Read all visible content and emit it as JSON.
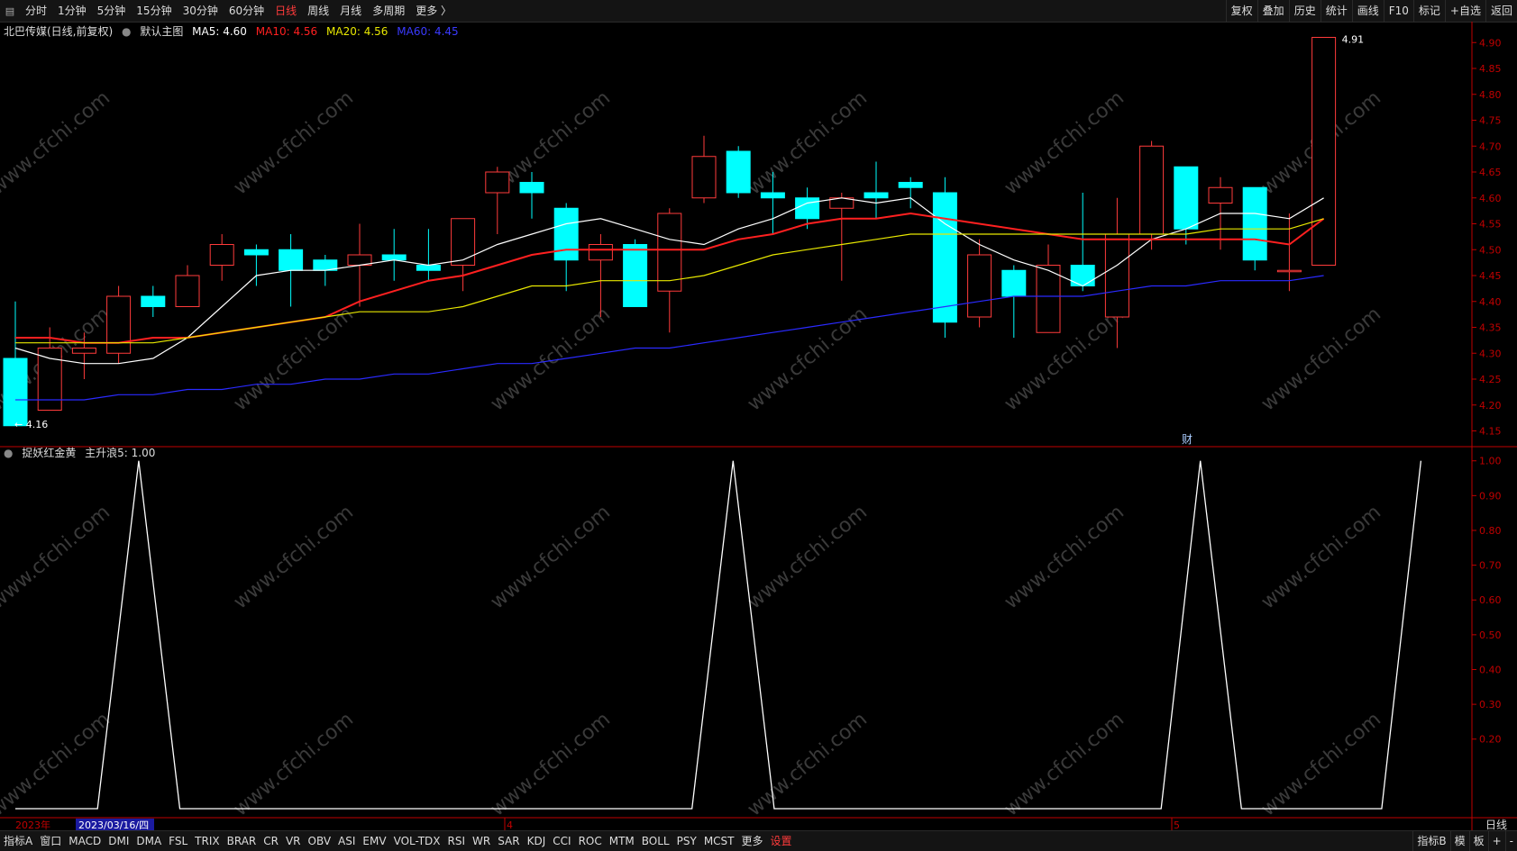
{
  "topbar": {
    "periods": [
      "分时",
      "1分钟",
      "5分钟",
      "15分钟",
      "30分钟",
      "60分钟",
      "日线",
      "周线",
      "月线",
      "多周期",
      "更多 〉"
    ],
    "active_period": "日线",
    "tools": [
      "复权",
      "叠加",
      "历史",
      "统计",
      "画线",
      "F10",
      "标记",
      "+自选",
      "返回"
    ]
  },
  "legend_main": {
    "stock": "北巴传媒(日线,前复权)",
    "main_label": "默认主图",
    "ma5": "MA5: 4.60",
    "ma10": "MA10: 4.56",
    "ma20": "MA20: 4.56",
    "ma60": "MA60: 4.45"
  },
  "legend_sub": {
    "name": "捉妖红金黄",
    "value": "主升浪5: 1.00"
  },
  "annotations": {
    "high": "4.91",
    "low": "4.16",
    "fin_marker": "财"
  },
  "xaxis": {
    "year": "2023年",
    "cursor_date": "2023/03/16/四",
    "month4": "4",
    "month5": "5",
    "period_label": "日线"
  },
  "bottombar": {
    "items": [
      "指标A",
      "窗口",
      "MACD",
      "DMI",
      "DMA",
      "FSL",
      "TRIX",
      "BRAR",
      "CR",
      "VR",
      "OBV",
      "ASI",
      "EMV",
      "VOL-TDX",
      "RSI",
      "WR",
      "SAR",
      "KDJ",
      "CCI",
      "ROC",
      "MTM",
      "BOLL",
      "PSY",
      "MCST",
      "更多",
      "设置"
    ],
    "right": [
      "指标B",
      "模",
      "板",
      "+",
      "-"
    ]
  },
  "watermark": "www.cfchi.com",
  "colors": {
    "up": "#ff3b3b",
    "down": "#00ffff",
    "ma5": "#ffffff",
    "ma10": "#ff2020",
    "ma20": "#e8e800",
    "ma60": "#2a2aff",
    "axis": "#c00000",
    "indicator": "#ffffff"
  },
  "chart_data": [
    {
      "type": "candlestick",
      "ylim": [
        4.13,
        4.93
      ],
      "y_ticks": [
        "4.15",
        "4.20",
        "4.25",
        "4.30",
        "4.35",
        "4.40",
        "4.45",
        "4.50",
        "4.55",
        "4.60",
        "4.65",
        "4.70",
        "4.75",
        "4.80",
        "4.85",
        "4.90"
      ],
      "candles": [
        {
          "o": 4.29,
          "c": 4.16,
          "h": 4.4,
          "l": 4.16
        },
        {
          "o": 4.19,
          "c": 4.31,
          "h": 4.35,
          "l": 4.19
        },
        {
          "o": 4.3,
          "c": 4.31,
          "h": 4.34,
          "l": 4.25
        },
        {
          "o": 4.3,
          "c": 4.41,
          "h": 4.43,
          "l": 4.28
        },
        {
          "o": 4.41,
          "c": 4.39,
          "h": 4.43,
          "l": 4.37
        },
        {
          "o": 4.39,
          "c": 4.45,
          "h": 4.47,
          "l": 4.39
        },
        {
          "o": 4.47,
          "c": 4.51,
          "h": 4.53,
          "l": 4.44
        },
        {
          "o": 4.5,
          "c": 4.49,
          "h": 4.51,
          "l": 4.43
        },
        {
          "o": 4.5,
          "c": 4.46,
          "h": 4.53,
          "l": 4.39
        },
        {
          "o": 4.48,
          "c": 4.46,
          "h": 4.49,
          "l": 4.43
        },
        {
          "o": 4.47,
          "c": 4.49,
          "h": 4.55,
          "l": 4.39
        },
        {
          "o": 4.49,
          "c": 4.48,
          "h": 4.54,
          "l": 4.44
        },
        {
          "o": 4.47,
          "c": 4.46,
          "h": 4.54,
          "l": 4.44
        },
        {
          "o": 4.47,
          "c": 4.56,
          "h": 4.56,
          "l": 4.42
        },
        {
          "o": 4.61,
          "c": 4.65,
          "h": 4.66,
          "l": 4.53
        },
        {
          "o": 4.63,
          "c": 4.61,
          "h": 4.65,
          "l": 4.56
        },
        {
          "o": 4.58,
          "c": 4.48,
          "h": 4.59,
          "l": 4.42
        },
        {
          "o": 4.48,
          "c": 4.51,
          "h": 4.53,
          "l": 4.37
        },
        {
          "o": 4.51,
          "c": 4.39,
          "h": 4.52,
          "l": 4.39
        },
        {
          "o": 4.42,
          "c": 4.57,
          "h": 4.58,
          "l": 4.34
        },
        {
          "o": 4.6,
          "c": 4.68,
          "h": 4.72,
          "l": 4.59
        },
        {
          "o": 4.69,
          "c": 4.61,
          "h": 4.7,
          "l": 4.6
        },
        {
          "o": 4.61,
          "c": 4.6,
          "h": 4.65,
          "l": 4.53
        },
        {
          "o": 4.6,
          "c": 4.56,
          "h": 4.62,
          "l": 4.54
        },
        {
          "o": 4.58,
          "c": 4.6,
          "h": 4.61,
          "l": 4.44
        },
        {
          "o": 4.61,
          "c": 4.6,
          "h": 4.67,
          "l": 4.56
        },
        {
          "o": 4.63,
          "c": 4.62,
          "h": 4.64,
          "l": 4.58
        },
        {
          "o": 4.61,
          "c": 4.36,
          "h": 4.64,
          "l": 4.33
        },
        {
          "o": 4.37,
          "c": 4.49,
          "h": 4.52,
          "l": 4.35
        },
        {
          "o": 4.46,
          "c": 4.41,
          "h": 4.47,
          "l": 4.33
        },
        {
          "o": 4.34,
          "c": 4.47,
          "h": 4.51,
          "l": 4.34
        },
        {
          "o": 4.47,
          "c": 4.43,
          "h": 4.61,
          "l": 4.42
        },
        {
          "o": 4.37,
          "c": 4.53,
          "h": 4.6,
          "l": 4.31
        },
        {
          "o": 4.53,
          "c": 4.7,
          "h": 4.71,
          "l": 4.5
        },
        {
          "o": 4.66,
          "c": 4.54,
          "h": 4.66,
          "l": 4.51
        },
        {
          "o": 4.59,
          "c": 4.62,
          "h": 4.64,
          "l": 4.5
        },
        {
          "o": 4.62,
          "c": 4.48,
          "h": 4.62,
          "l": 4.46
        },
        {
          "o": 4.46,
          "c": 4.46,
          "h": 4.57,
          "l": 4.42
        },
        {
          "o": 4.47,
          "c": 4.91,
          "h": 4.91,
          "l": 4.47
        }
      ],
      "series": [
        {
          "name": "MA5",
          "values": [
            4.31,
            4.29,
            4.28,
            4.28,
            4.29,
            4.33,
            4.39,
            4.45,
            4.46,
            4.46,
            4.47,
            4.48,
            4.47,
            4.48,
            4.51,
            4.53,
            4.55,
            4.56,
            4.54,
            4.52,
            4.51,
            4.54,
            4.56,
            4.59,
            4.6,
            4.59,
            4.6,
            4.55,
            4.51,
            4.48,
            4.46,
            4.43,
            4.47,
            4.52,
            4.54,
            4.57,
            4.57,
            4.56,
            4.6
          ]
        },
        {
          "name": "MA10",
          "values": [
            4.33,
            4.33,
            4.32,
            4.32,
            4.33,
            4.33,
            4.34,
            4.35,
            4.36,
            4.37,
            4.4,
            4.42,
            4.44,
            4.45,
            4.47,
            4.49,
            4.5,
            4.5,
            4.5,
            4.5,
            4.5,
            4.52,
            4.53,
            4.55,
            4.56,
            4.56,
            4.57,
            4.56,
            4.55,
            4.54,
            4.53,
            4.52,
            4.52,
            4.52,
            4.52,
            4.52,
            4.52,
            4.51,
            4.56
          ]
        },
        {
          "name": "MA20",
          "values": [
            4.32,
            4.32,
            4.32,
            4.32,
            4.32,
            4.33,
            4.34,
            4.35,
            4.36,
            4.37,
            4.38,
            4.38,
            4.38,
            4.39,
            4.41,
            4.43,
            4.43,
            4.44,
            4.44,
            4.44,
            4.45,
            4.47,
            4.49,
            4.5,
            4.51,
            4.52,
            4.53,
            4.53,
            4.53,
            4.53,
            4.53,
            4.53,
            4.53,
            4.53,
            4.53,
            4.54,
            4.54,
            4.54,
            4.56
          ]
        },
        {
          "name": "MA60",
          "values": [
            4.21,
            4.21,
            4.21,
            4.22,
            4.22,
            4.23,
            4.23,
            4.24,
            4.24,
            4.25,
            4.25,
            4.26,
            4.26,
            4.27,
            4.28,
            4.28,
            4.29,
            4.3,
            4.31,
            4.31,
            4.32,
            4.33,
            4.34,
            4.35,
            4.36,
            4.37,
            4.38,
            4.39,
            4.4,
            4.41,
            4.41,
            4.41,
            4.42,
            4.43,
            4.43,
            4.44,
            4.44,
            4.44,
            4.45
          ]
        }
      ]
    },
    {
      "type": "line",
      "name": "主升浪5",
      "ylim": [
        0,
        1.02
      ],
      "y_ticks": [
        "0.20",
        "0.30",
        "0.40",
        "0.50",
        "0.60",
        "0.70",
        "0.80",
        "0.90",
        "1.00"
      ],
      "points": [
        [
          0,
          0
        ],
        [
          4.4,
          0
        ],
        [
          6.6,
          1
        ],
        [
          8.8,
          0
        ],
        [
          36.2,
          0
        ],
        [
          38.4,
          1
        ],
        [
          40.6,
          0
        ],
        [
          61.3,
          0
        ],
        [
          63.4,
          1
        ],
        [
          65.6,
          0
        ],
        [
          73.1,
          0
        ],
        [
          75.2,
          1
        ]
      ],
      "x_range": [
        0,
        76
      ]
    }
  ]
}
